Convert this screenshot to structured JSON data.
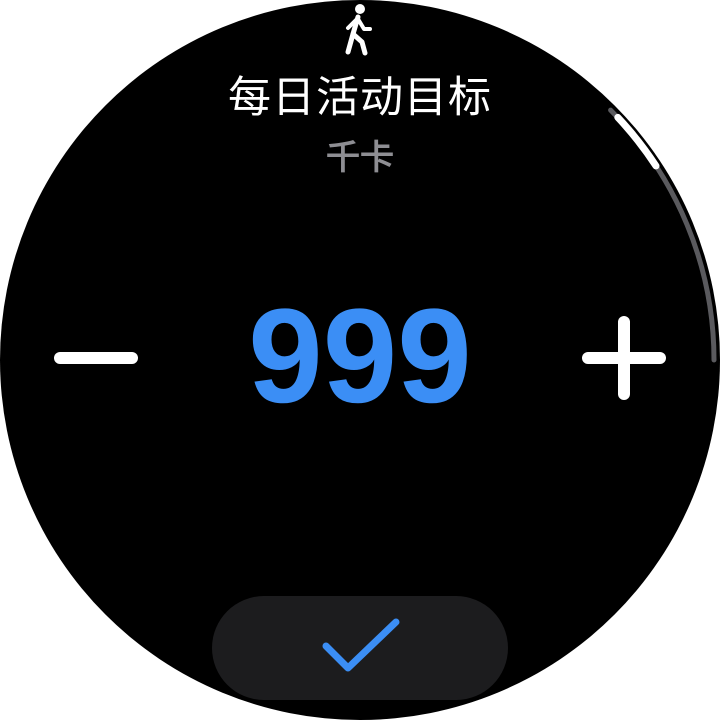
{
  "screen": {
    "title": "每日活动目标",
    "unit": "千卡",
    "value": "999"
  },
  "scroll": {
    "position_fraction": 0.05
  },
  "colors": {
    "background": "#000000",
    "accent": "#3b8ef5",
    "unit_text": "#8e8e93",
    "button_bg": "#1c1c1e"
  },
  "icons": {
    "activity": "walking-person-icon",
    "decrease": "minus-icon",
    "increase": "plus-icon",
    "confirm": "checkmark-icon"
  }
}
